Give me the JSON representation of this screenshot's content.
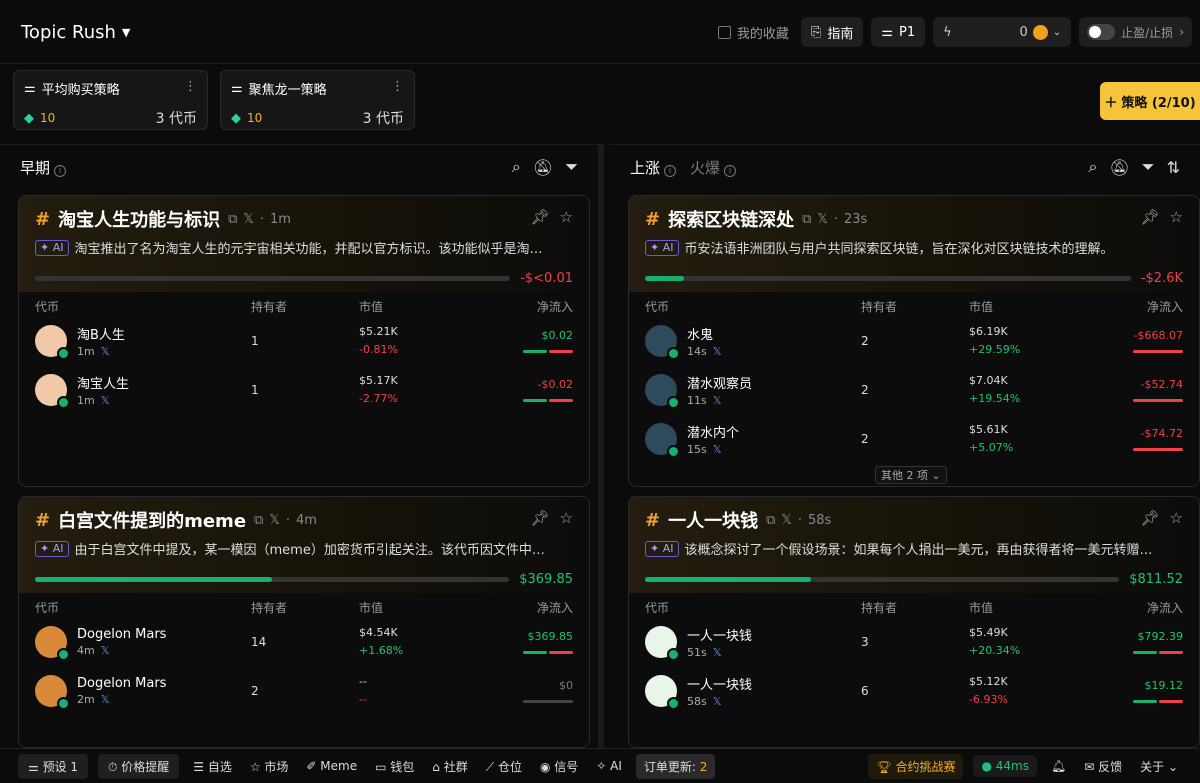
{
  "app": {
    "title": "Topic Rush"
  },
  "topbar": {
    "favorites": "我的收藏",
    "guide": "指南",
    "preset": "P1",
    "balance": "0",
    "tp_sl": "止盈/止损"
  },
  "strategies": [
    {
      "name": "平均购买策略",
      "points": "10",
      "count": "3 代币"
    },
    {
      "name": "聚焦龙一策略",
      "points": "10",
      "count": "3 代币"
    }
  ],
  "add_strategy": "策略 (2/10)",
  "left_panel": {
    "tab": "早期",
    "cards": [
      {
        "title": "淘宝人生功能与标识",
        "age": "1m",
        "ai_label": "AI",
        "desc": "淘宝推出了名为淘宝人生的元宇宙相关功能，并配以官方标识。该功能似乎是淘…",
        "net": "-$<0.01",
        "net_fill": 0,
        "cols": [
          "代币",
          "持有者",
          "市值",
          "净流入"
        ],
        "rows": [
          {
            "name": "淘B人生",
            "age": "1m",
            "holders": "1",
            "mcap": "$5.21K",
            "change": "-0.81%",
            "flow": "$0.02"
          },
          {
            "name": "淘宝人生",
            "age": "1m",
            "holders": "1",
            "mcap": "$5.17K",
            "change": "-2.77%",
            "flow": "-$0.02"
          }
        ]
      },
      {
        "title": "白宫文件提到的meme",
        "age": "4m",
        "ai_label": "AI",
        "desc": "由于白宫文件中提及，某一模因（meme）加密货币引起关注。该代币因文件中…",
        "net": "$369.85",
        "net_fill": 0.5,
        "cols": [
          "代币",
          "持有者",
          "市值",
          "净流入"
        ],
        "rows": [
          {
            "name": "Dogelon Mars",
            "age": "4m",
            "holders": "14",
            "mcap": "$4.54K",
            "change": "+1.68%",
            "flow": "$369.85"
          },
          {
            "name": "Dogelon Mars",
            "age": "2m",
            "holders": "2",
            "mcap": "--",
            "change": "--",
            "flow": "$0"
          }
        ]
      }
    ]
  },
  "right_panel": {
    "tab_active": "上涨",
    "tab_other": "火爆",
    "more": "其他 2 项",
    "cards": [
      {
        "title": "探索区块链深处",
        "age": "23s",
        "ai_label": "AI",
        "desc": "币安法语非洲团队与用户共同探索区块链，旨在深化对区块链技术的理解。",
        "net": "-$2.6K",
        "net_fill": 0.08,
        "cols": [
          "代币",
          "持有者",
          "市值",
          "净流入"
        ],
        "rows": [
          {
            "name": "水鬼",
            "age": "14s",
            "holders": "2",
            "mcap": "$6.19K",
            "change": "+29.59%",
            "flow": "-$668.07"
          },
          {
            "name": "潜水观察员",
            "age": "11s",
            "holders": "2",
            "mcap": "$7.04K",
            "change": "+19.54%",
            "flow": "-$52.74"
          },
          {
            "name": "潜水内个",
            "age": "15s",
            "holders": "2",
            "mcap": "$5.61K",
            "change": "+5.07%",
            "flow": "-$74.72"
          }
        ]
      },
      {
        "title": "一人一块钱",
        "age": "58s",
        "ai_label": "AI",
        "desc": "该概念探讨了一个假设场景：如果每个人捐出一美元，再由获得者将一美元转赠…",
        "net": "$811.52",
        "net_fill": 0.35,
        "cols": [
          "代币",
          "持有者",
          "市值",
          "净流入"
        ],
        "rows": [
          {
            "name": "一人一块钱",
            "age": "51s",
            "holders": "3",
            "mcap": "$5.49K",
            "change": "+20.34%",
            "flow": "$792.39"
          },
          {
            "name": "一人一块钱",
            "age": "58s",
            "holders": "6",
            "mcap": "$5.12K",
            "change": "-6.93%",
            "flow": "$19.12"
          }
        ]
      }
    ]
  },
  "statusbar": {
    "preset": "预设 1",
    "price_alert": "价格提醒",
    "watchlist": "自选",
    "market": "市场",
    "meme": "Meme",
    "wallet": "钱包",
    "community": "社群",
    "positions": "仓位",
    "signal": "信号",
    "ai": "AI",
    "order_update_label": "订单更新:",
    "order_update_count": "2",
    "contest": "合约挑战赛",
    "ping": "44ms",
    "feedback": "反馈",
    "about": "关于"
  }
}
